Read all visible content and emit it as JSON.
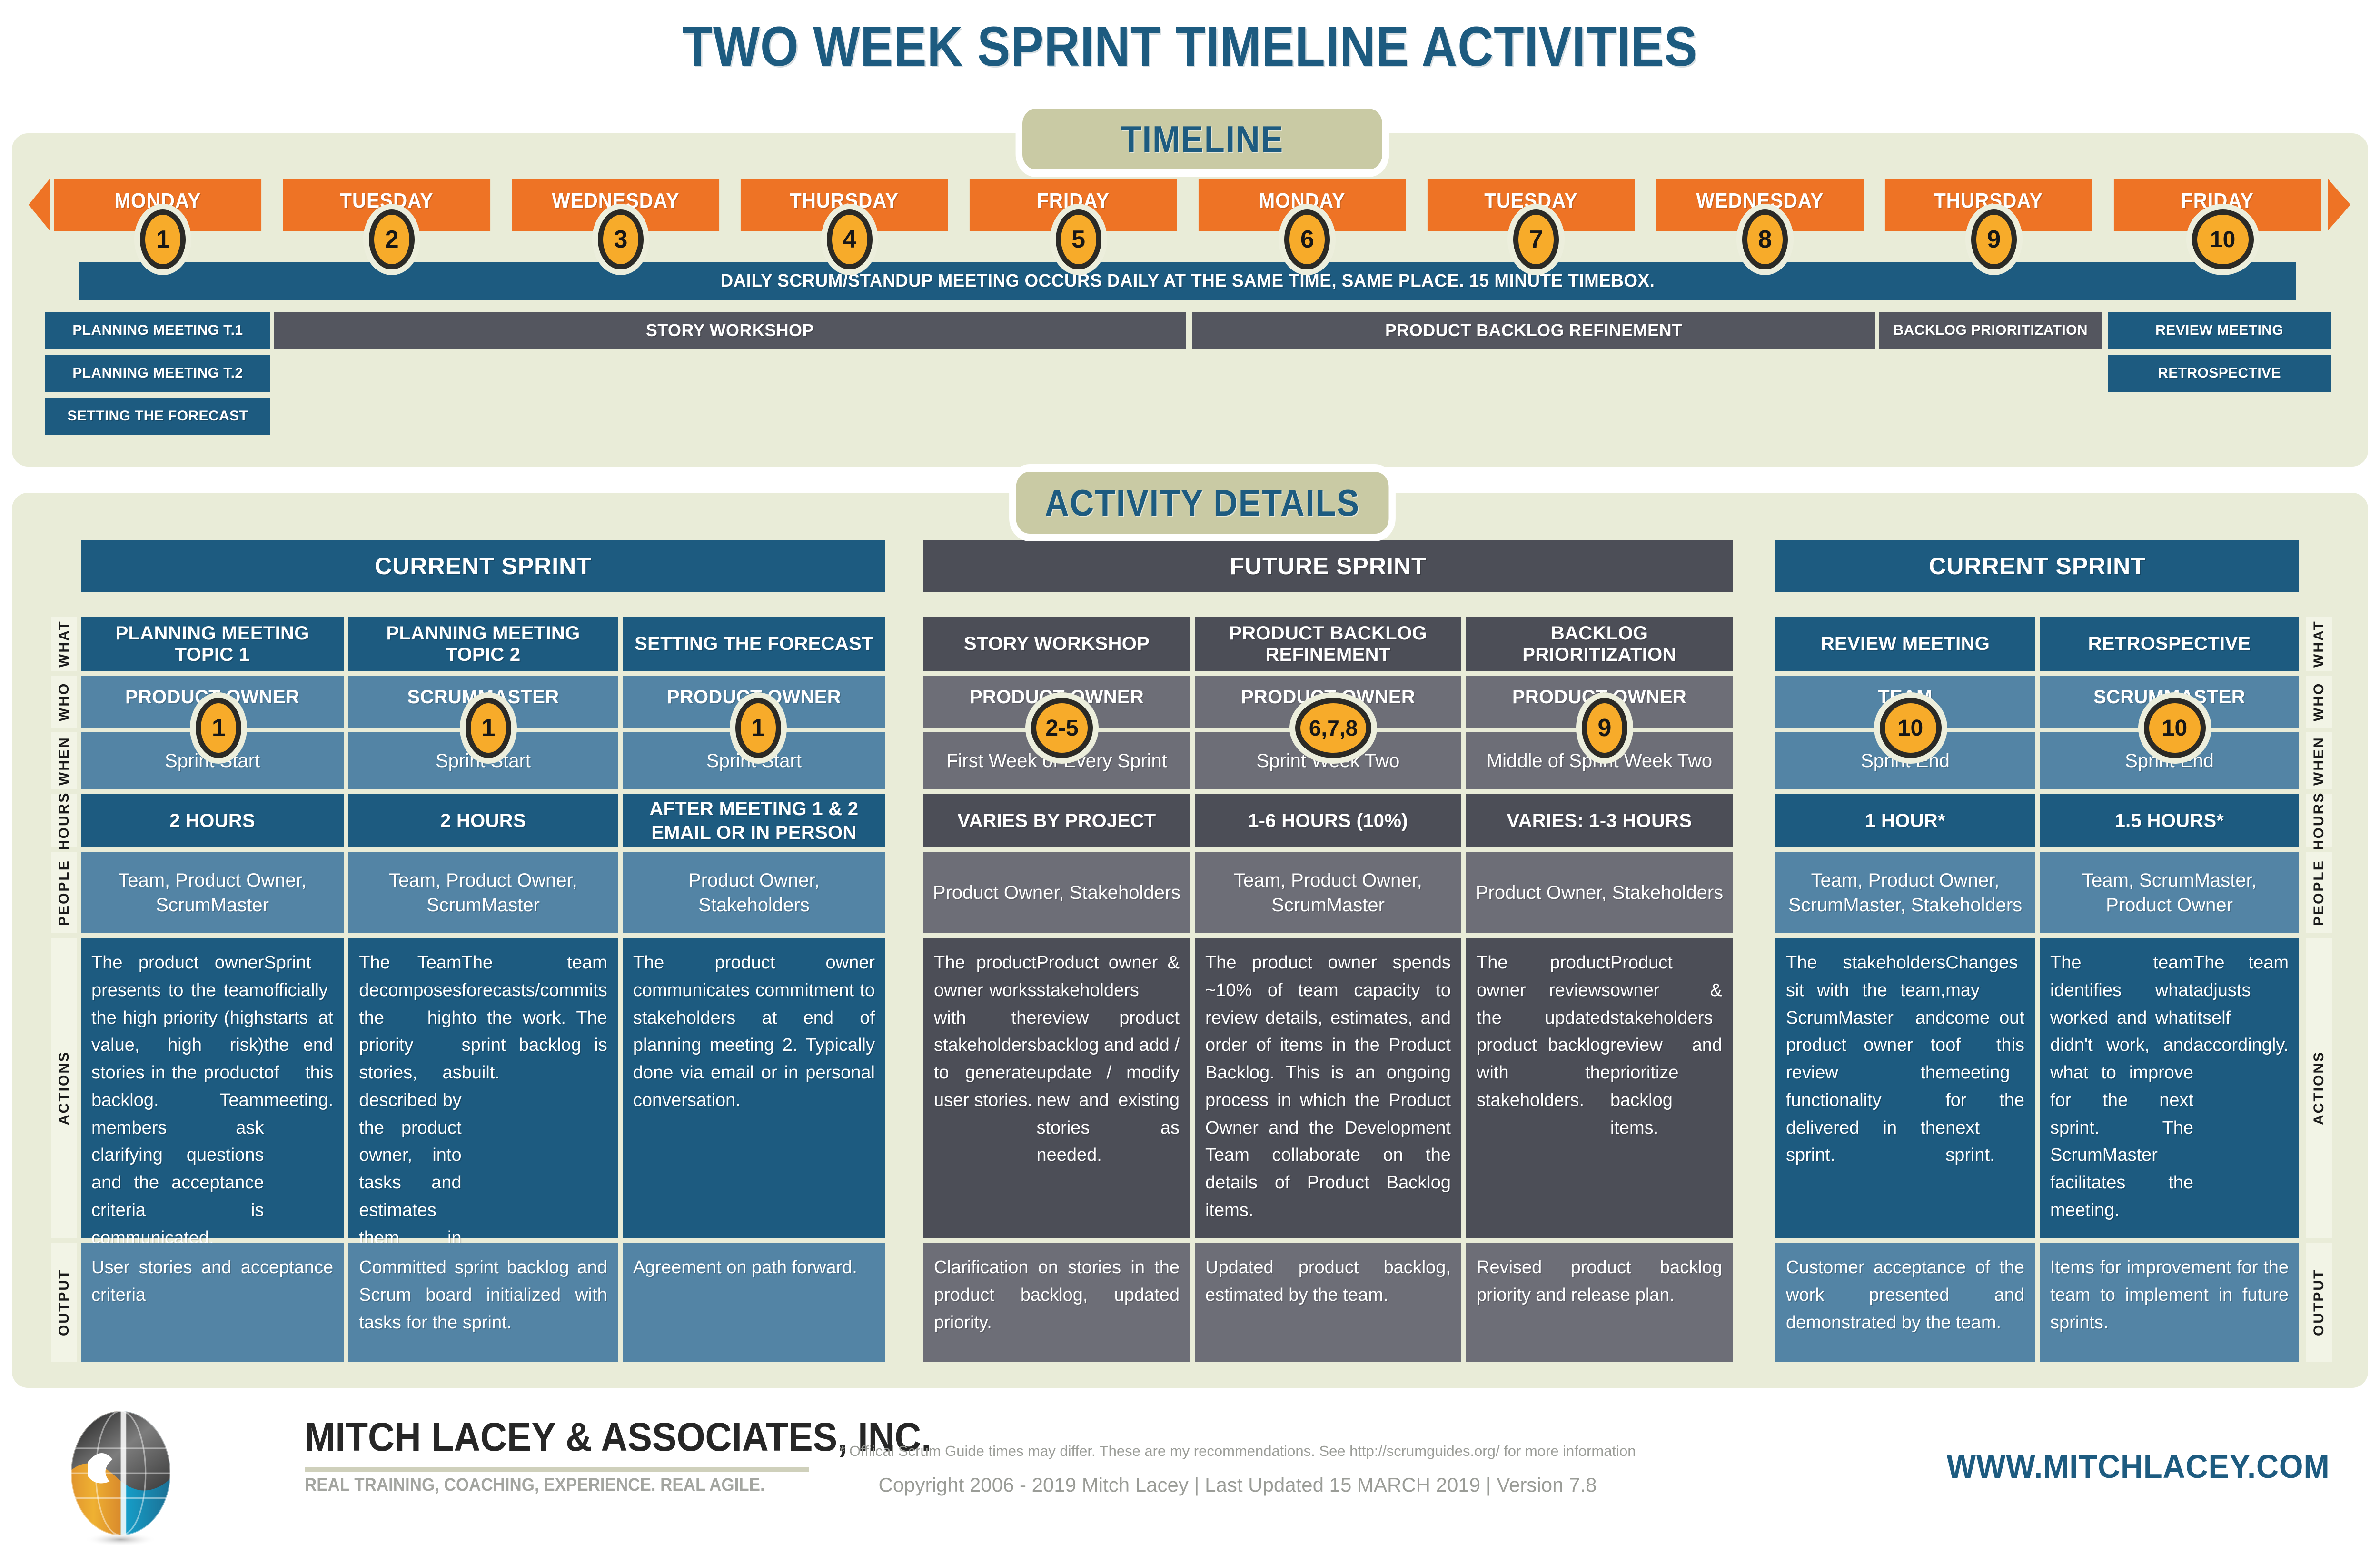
{
  "title": "TWO WEEK SPRINT TIMELINE ACTIVITIES",
  "badges": {
    "timeline": "TIMELINE",
    "activity_details": "ACTIVITY DETAILS"
  },
  "timeline": {
    "days": [
      {
        "label": "MONDAY",
        "num": "1"
      },
      {
        "label": "TUESDAY",
        "num": "2"
      },
      {
        "label": "WEDNESDAY",
        "num": "3"
      },
      {
        "label": "THURSDAY",
        "num": "4"
      },
      {
        "label": "FRIDAY",
        "num": "5"
      },
      {
        "label": "MONDAY",
        "num": "6"
      },
      {
        "label": "TUESDAY",
        "num": "7"
      },
      {
        "label": "WEDNESDAY",
        "num": "8"
      },
      {
        "label": "THURSDAY",
        "num": "9"
      },
      {
        "label": "FRIDAY",
        "num": "10"
      }
    ],
    "scrum_bar": "DAILY SCRUM/STANDUP MEETING OCCURS DAILY AT THE SAME TIME, SAME PLACE. 15 MINUTE TIMEBOX.",
    "bars": [
      {
        "label": "PLANNING MEETING T.1",
        "color": "blue"
      },
      {
        "label": "STORY WORKSHOP",
        "color": "gray"
      },
      {
        "label": "PRODUCT BACKLOG REFINEMENT",
        "color": "gray"
      },
      {
        "label": "BACKLOG PRIORITIZATION",
        "color": "gray"
      },
      {
        "label": "REVIEW MEETING",
        "color": "blue"
      },
      {
        "label": "PLANNING MEETING T.2",
        "color": "blue"
      },
      {
        "label": "RETROSPECTIVE",
        "color": "blue"
      },
      {
        "label": "SETTING THE FORECAST",
        "color": "blue"
      }
    ]
  },
  "row_labels": [
    "WHAT",
    "WHO",
    "WHEN",
    "HOURS",
    "PEOPLE",
    "ACTIONS",
    "OUTPUT"
  ],
  "sections": [
    {
      "heading": "CURRENT SPRINT",
      "theme": "blue",
      "columns": [
        {
          "what": "PLANNING MEETING TOPIC 1",
          "who": "PRODUCT OWNER",
          "marker": "1",
          "when": "Sprint Start",
          "hours": "2 HOURS",
          "people": "Team, Product Owner, ScrumMaster",
          "actions": [
            "The product owner presents to the team the high priority (high value, high risk) stories in the product backlog. Team members ask clarifying questions and the acceptance criteria is communicated.",
            "Sprint officially starts at the end of this meeting."
          ],
          "output": [
            "User stories and acceptance criteria"
          ]
        },
        {
          "what": "PLANNING MEETING TOPIC 2",
          "who": "SCRUMMASTER",
          "marker": "1",
          "when": "Sprint Start",
          "hours": "2 HOURS",
          "people": "Team, Product Owner, ScrumMaster",
          "actions": [
            "The Team decomposes the high priority stories, as described by the product owner, into tasks and estimates them in hours.",
            "The team forecasts/commits to the work. The sprint backlog is built."
          ],
          "output": [
            "Committed sprint backlog and Scrum board initialized with tasks for the sprint."
          ]
        },
        {
          "what": "SETTING THE FORECAST",
          "who": "PRODUCT OWNER",
          "marker": "1",
          "when": "Sprint Start",
          "hours": "AFTER MEETING 1 & 2\nEMAIL OR IN PERSON",
          "people": "Product Owner, Stakeholders",
          "actions": [
            "The product owner communicates commitment to stakeholders at end of planning meeting 2. Typically done via email or in personal conversation."
          ],
          "output": [
            "Agreement on path forward."
          ]
        }
      ]
    },
    {
      "heading": "FUTURE SPRINT",
      "theme": "gray",
      "columns": [
        {
          "what": "STORY WORKSHOP",
          "who": "PRODUCT OWNER",
          "marker": "2-5",
          "when": "First Week of Every Sprint",
          "hours": "VARIES BY PROJECT",
          "people": "Product Owner, Stakeholders",
          "actions": [
            "The product owner works with the stakeholders to generate user stories.",
            "Product owner & stakeholders review product backlog and add / update / modify new and existing stories as needed."
          ],
          "output": [
            "Clarification on stories in the product backlog, updated priority."
          ]
        },
        {
          "what": "PRODUCT BACKLOG REFINEMENT",
          "who": "PRODUCT OWNER",
          "marker": "6,7,8",
          "when": "Sprint Week Two",
          "hours": "1-6 HOURS (10%)",
          "people": "Team, Product Owner, ScrumMaster",
          "actions": [
            "The product owner spends ~10% of team capacity to review details, estimates, and order of items in the Product Backlog. This is an ongoing process in which the Product Owner and the Development Team collaborate on the details of Product Backlog items."
          ],
          "output": [
            "Updated product backlog, estimated by the team."
          ]
        },
        {
          "what": "BACKLOG PRIORITIZATION",
          "who": "PRODUCT OWNER",
          "marker": "9",
          "when": "Middle of Sprint Week Two",
          "hours": "VARIES: 1-3 HOURS",
          "people": "Product Owner, Stakeholders",
          "actions": [
            "The product owner reviews the updated product backlog with the stakeholders.",
            "Product owner & stakeholders review and prioritize backlog items."
          ],
          "output": [
            "Revised product backlog priority and release plan."
          ]
        }
      ]
    },
    {
      "heading": "CURRENT SPRINT",
      "theme": "blue",
      "columns": [
        {
          "what": "REVIEW MEETING",
          "who": "TEAM",
          "marker": "10",
          "when": "Sprint End",
          "hours": "1 HOUR*",
          "people": "Team, Product Owner, ScrumMaster, Stakeholders",
          "actions": [
            "The stakeholders sit with the team, ScrumMaster and product owner to review the functionality delivered in the sprint.",
            "Changes may come out of this meeting for the next sprint."
          ],
          "output": [
            "Customer acceptance of the work presented and demonstrated by the team."
          ]
        },
        {
          "what": "RETROSPECTIVE",
          "who": "SCRUMMASTER",
          "marker": "10",
          "when": "Sprint End",
          "hours": "1.5 HOURS*",
          "people": "Team, ScrumMaster, Product Owner",
          "actions": [
            "The team identifies what worked and what didn't work, and what to improve for the next sprint. The ScrumMaster facilitates the meeting.",
            "The team adjusts itself accordingly."
          ],
          "output": [
            "Items for improvement for the team to implement in future sprints."
          ]
        }
      ]
    }
  ],
  "footer": {
    "company": "MITCH LACEY & ASSOCIATES, INC.",
    "tagline": "REAL TRAINING, COACHING, EXPERIENCE. REAL AGILE.",
    "footnote": "* Offiical Scrum Guide times may differ. These are my recommendations. See http://scrumguides.org/ for more information",
    "copyright": "Copyright 2006 - 2019 Mitch Lacey  |  Last Updated 15 MARCH 2019 | Version 7.8",
    "website": "WWW.MITCHLACEY.COM"
  },
  "colors": {
    "orange": "#ee7325",
    "dark_blue": "#1d5b80",
    "light_blue": "#5384a5",
    "dark_gray": "#4c4e57",
    "light_gray": "#6d6e77",
    "panel_bg": "#e9ecd8",
    "badge_bg": "#c9caa4",
    "marker_fill": "#f7ab2a"
  }
}
